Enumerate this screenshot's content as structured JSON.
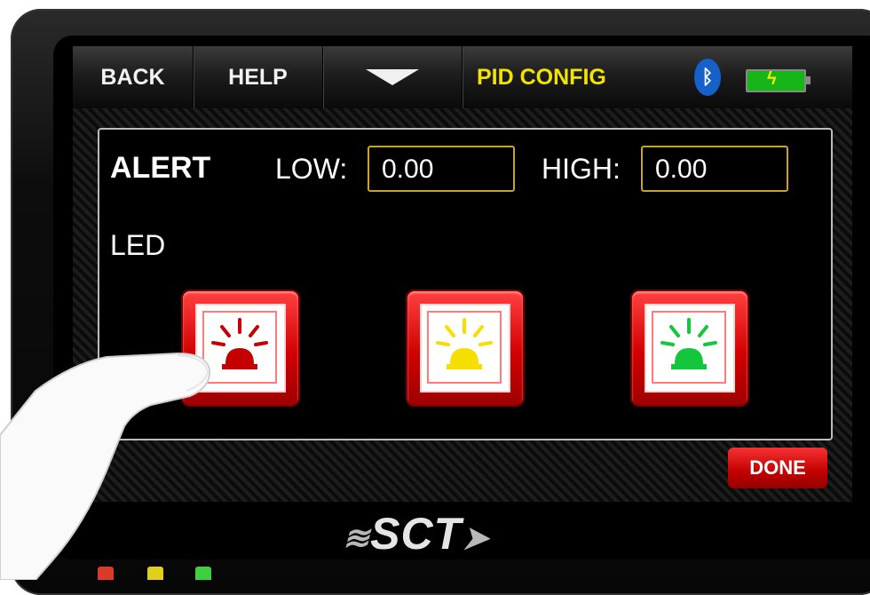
{
  "topbar": {
    "back_label": "BACK",
    "help_label": "HELP",
    "title": "PID CONFIG",
    "bluetooth_icon": "bluetooth-icon",
    "battery_icon": "battery-charging-icon"
  },
  "alert": {
    "heading": "ALERT",
    "low_label": "LOW:",
    "low_value": "0.00",
    "high_label": "HIGH:",
    "high_value": "0.00"
  },
  "led": {
    "label": "LED",
    "buttons": [
      {
        "name": "red",
        "color": "#c40000"
      },
      {
        "name": "yellow",
        "color": "#f6df00"
      },
      {
        "name": "green",
        "color": "#14c63c"
      }
    ]
  },
  "done_label": "DONE",
  "brand": "SCT",
  "indicator_colors": [
    "#d93a2a",
    "#e0d01a",
    "#3fcf3f"
  ]
}
